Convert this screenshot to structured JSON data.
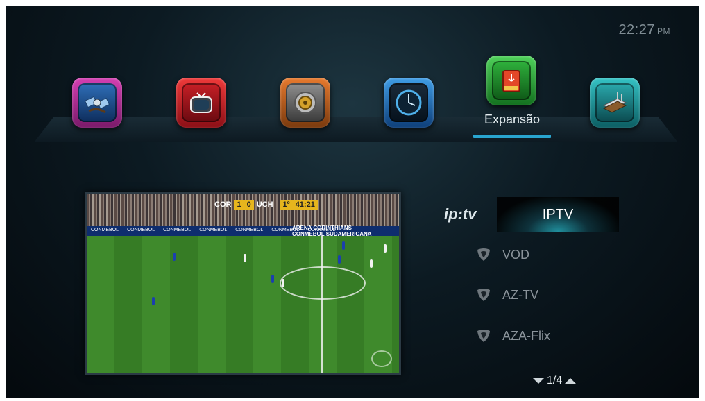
{
  "clock": {
    "time": "22:27",
    "ampm": "PM"
  },
  "top_menu": {
    "selected_label": "Expansão",
    "apps": [
      {
        "name": "satellite-app-icon"
      },
      {
        "name": "tv-app-icon"
      },
      {
        "name": "settings-app-icon"
      },
      {
        "name": "clock-app-icon"
      },
      {
        "name": "usb-expansion-app-icon"
      },
      {
        "name": "network-router-app-icon"
      }
    ]
  },
  "video": {
    "team_home": "COR",
    "score_home": "1",
    "score_away": "0",
    "team_away": "UCH",
    "period": "1º",
    "match_time": "41:21",
    "arena_line1": "ARENA CORINTHIANS",
    "arena_line2": "CONMEBOL SUDAMERICANA"
  },
  "side_menu": {
    "logo": "ip:tv",
    "selected_tab": "IPTV",
    "items": [
      {
        "label": "VOD"
      },
      {
        "label": "AZ-TV"
      },
      {
        "label": "AZA-Flix"
      }
    ],
    "pager": "1/4"
  },
  "colors": {
    "accent": "#29a5cf",
    "selected_tab_glow": "#27b8c8",
    "inactive_text": "#8a939a"
  }
}
